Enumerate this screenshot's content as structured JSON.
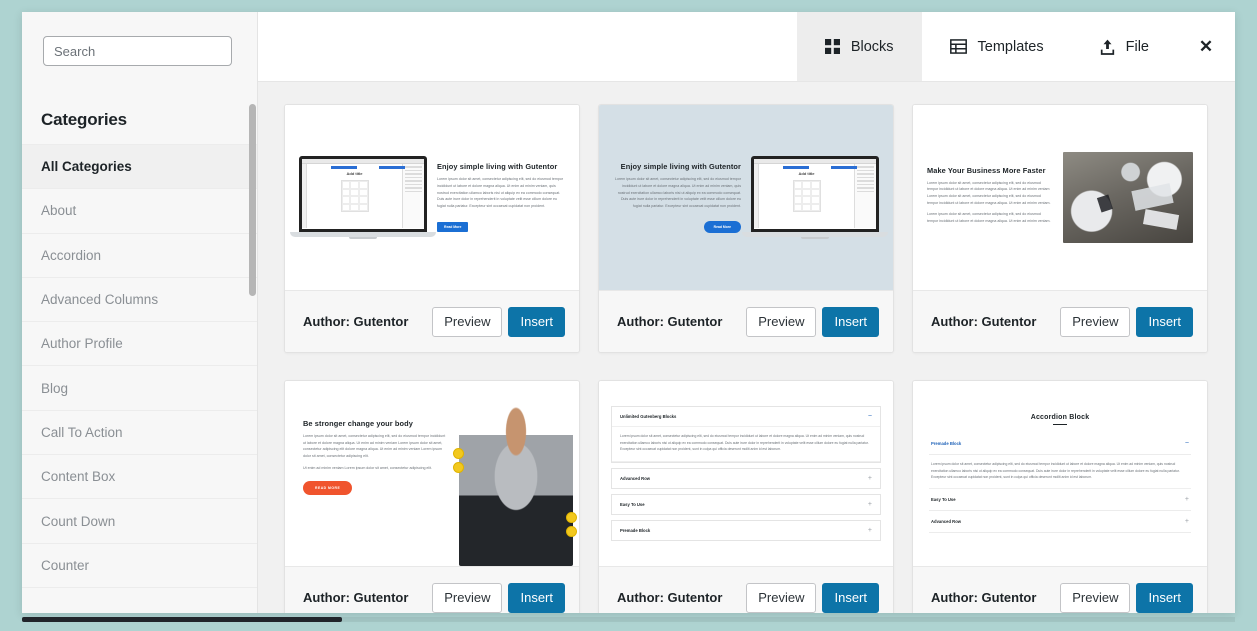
{
  "theme": {
    "backdrop_color": "#aed3d1",
    "accent_blue": "#0d74a8",
    "sidebar_bg": "#f7f7f7",
    "grid_bg": "#f1f1f1"
  },
  "sidebar": {
    "search": {
      "placeholder": "Search",
      "value": ""
    },
    "heading": "Categories",
    "items": [
      {
        "label": "All Categories",
        "active": true
      },
      {
        "label": "About",
        "active": false
      },
      {
        "label": "Accordion",
        "active": false
      },
      {
        "label": "Advanced Columns",
        "active": false
      },
      {
        "label": "Author Profile",
        "active": false
      },
      {
        "label": "Blog",
        "active": false
      },
      {
        "label": "Call To Action",
        "active": false
      },
      {
        "label": "Content Box",
        "active": false
      },
      {
        "label": "Count Down",
        "active": false
      },
      {
        "label": "Counter",
        "active": false
      }
    ]
  },
  "tabs": [
    {
      "label": "Blocks",
      "icon": "grid-icon",
      "active": false
    },
    {
      "label": "Templates",
      "icon": "table-icon",
      "active": true
    },
    {
      "label": "File",
      "icon": "upload-icon",
      "active": false
    }
  ],
  "close_label": "✕",
  "card_actions": {
    "preview_label": "Preview",
    "insert_label": "Insert"
  },
  "cards": [
    {
      "author": "Author: Gutentor",
      "layout": "laptop-right",
      "bg": "#ffffff",
      "heading": "Enjoy simple living with Gutentor",
      "body": "Lorem ipsum dolor sit amet, consectetur adipiscing elit, sed do eiusmod tempor incididunt ut labore et dolore magna aliqua. Ut enim ad minim veniam, quis nostrud exercitation ullamco laboris nisi ut aliquip ex ea commodo consequat. Duis aute irure dolor in reprehenderit in voluptate velit esse cillum dolore eu fugiat nulla pariatur. Excepteur sint occaecat cupidatat non proident.",
      "button": "Read More",
      "laptop_title": "Add title"
    },
    {
      "author": "Author: Gutentor",
      "layout": "laptop-left",
      "bg": "#d4dfe6",
      "heading": "Enjoy simple living with Gutentor",
      "body": "Lorem ipsum dolor sit amet, consectetur adipiscing elit, sed do eiusmod tempor incididunt ut labore et dolore magna aliqua. Ut enim ad minim veniam, quis nostrud exercitation ullamco laboris nisi ut aliquip ex ea commodo consequat. Duis aute irure dolor in reprehenderit in voluptate velit esse cillum dolore eu fugiat nulla pariatur. Excepteur sint occaecat cupidatat non proident.",
      "button": "Read More",
      "laptop_title": "Add title"
    },
    {
      "author": "Author: Gutentor",
      "layout": "photo-meeting",
      "bg": "#ffffff",
      "heading": "Make Your Business More Faster",
      "body": "Lorem ipsum dolor sit amet, consectetur adipiscing elit, sed do eiusmod tempor incididunt ut labore et dolore magna aliqua. Ut enim ad minim veniam Lorem ipsum dolor sit amet, consectetur adipiscing elit, sed do eiusmod tempor incididunt ut labore et dolore magna aliqua. Ut enim ad minim veniam.",
      "body2": "Lorem ipsum dolor sit amet, consectetur adipiscing elit, sed do eiusmod tempor incididunt ut labore et dolore magna aliqua. Ut enim ad minim veniam."
    },
    {
      "author": "Author: Gutentor",
      "layout": "photo-fitness",
      "bg": "#ffffff",
      "heading": "Be stronger change your body",
      "body": "Lorem ipsum dolor sit amet, consectetur adipiscing elit, sed do eiusmod tempor incididunt ut labore et dolore magna aliqua. Ut enim ad minim veniam Lorem ipsum dolor sit amet, consectetur adipiscing elit dolore magna aliqua. Ut enim ad minim veniam Lorem ipsum dolor sit amet, consectetur adipiscing elit.",
      "body2": "Ut enim ad minim veniam Lorem ipsum dolor sit amet, consectetur adipiscing elit.",
      "button": "READ MORE"
    },
    {
      "author": "Author: Gutentor",
      "layout": "accordion-boxed",
      "bg": "#ffffff",
      "accordion": {
        "open_item": {
          "label": "Unlimited Gutenberg Blocks",
          "sign": "−",
          "body": "Lorem ipsum dolor sit amet, consectetur adipiscing elit, sed do eiusmod tempor incididunt ut labore et dolore magna aliqua. Ut enim ad minim veniam, quis nostrud exercitation ullamco laboris nisi ut aliquip ex ea commodo consequat. Duis aute irure dolor in reprehenderit in voluptate velit esse cillum dolore eu fugiat nulla pariatur. Excepteur sint occaecat cupidatat non proident, sunt in culpa qui officia deserunt mollit anim id est laborum."
        },
        "closed_items": [
          {
            "label": "Advanced Row",
            "sign": "+"
          },
          {
            "label": "Easy To Use",
            "sign": "+"
          },
          {
            "label": "Premade Block",
            "sign": "+"
          }
        ]
      }
    },
    {
      "author": "Author: Gutentor",
      "layout": "accordion-titled",
      "bg": "#ffffff",
      "accordion": {
        "title": "Accordion Block",
        "open_item": {
          "label": "Premade Block",
          "sign": "−",
          "body": "Lorem ipsum dolor sit amet, consectetur adipiscing elit, sed do eiusmod tempor incididunt ut labore et dolore magna aliqua. Ut enim ad minim veniam, quis nostrud exercitation ullamco laboris nisi ut aliquip ex ea commodo consequat. Duis aute irure dolor in reprehenderit in voluptate velit esse cillum dolore eu fugiat nulla pariatur. Excepteur sint occaecat cupidatat non proident, sunt in culpa qui officia deserunt mollit anim id est laborum."
        },
        "closed_items": [
          {
            "label": "Easy To Use",
            "sign": "+"
          },
          {
            "label": "Advanced Row",
            "sign": "+"
          }
        ]
      }
    }
  ]
}
